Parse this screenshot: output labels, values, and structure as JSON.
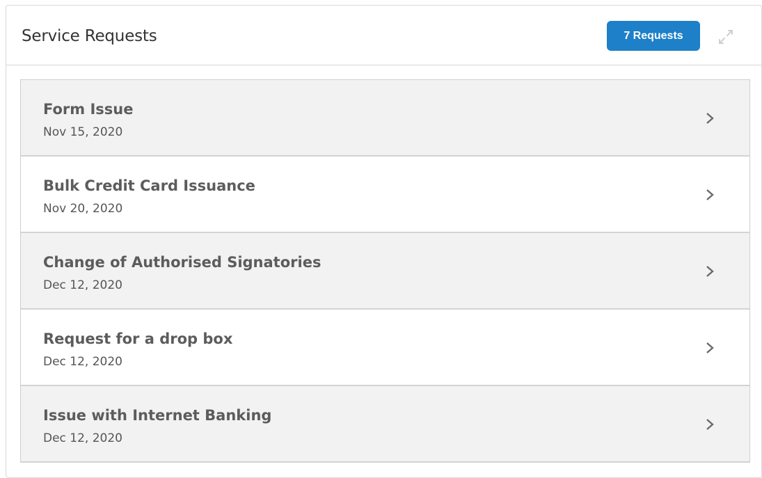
{
  "widget": {
    "title": "Service Requests",
    "badge_label": "7 Requests",
    "expand_icon": "expand-icon",
    "accent_color": "#1d80c8"
  },
  "requests": [
    {
      "title": "Form Issue",
      "date": "Nov 15, 2020"
    },
    {
      "title": "Bulk Credit Card Issuance",
      "date": "Nov 20, 2020"
    },
    {
      "title": "Change of Authorised Signatories",
      "date": "Dec 12, 2020"
    },
    {
      "title": "Request for a drop box",
      "date": "Dec 12, 2020"
    },
    {
      "title": "Issue with Internet Banking",
      "date": "Dec 12, 2020"
    }
  ],
  "row_icon": "chevron-right-icon"
}
